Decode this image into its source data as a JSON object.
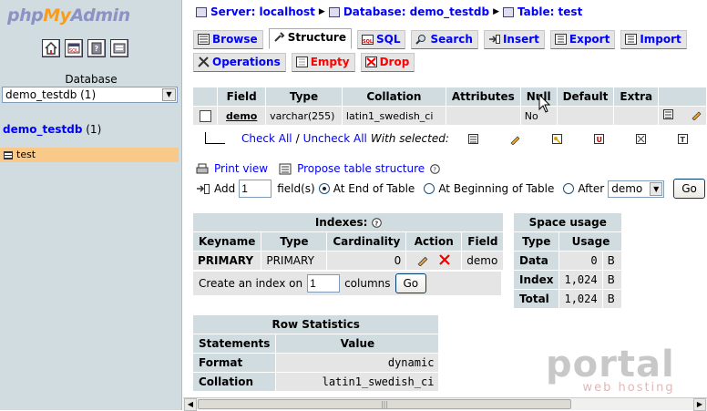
{
  "left": {
    "logo": {
      "php": "php",
      "my": "My",
      "admin": "Admin"
    },
    "nav_icons": [
      "home-icon",
      "sql-query-icon",
      "docs-icon",
      "info-icon"
    ],
    "database_label": "Database",
    "database_select": "demo_testdb (1)",
    "db_link": "demo_testdb",
    "db_count": "(1)",
    "table_item": "test"
  },
  "breadcrumb": {
    "server": "Server: localhost",
    "database": "Database: demo_testdb",
    "table": "Table: test"
  },
  "tabs_row1": [
    "Browse",
    "Structure",
    "SQL",
    "Search",
    "Insert",
    "Export",
    "Import"
  ],
  "tabs_row2": [
    "Operations",
    "Empty",
    "Drop"
  ],
  "structure": {
    "headers": [
      "Field",
      "Type",
      "Collation",
      "Attributes",
      "Null",
      "Default",
      "Extra"
    ],
    "rows": [
      {
        "field": "demo",
        "type": "varchar(255)",
        "collation": "latin1_swedish_ci",
        "attributes": "",
        "null": "No",
        "default": "",
        "extra": ""
      }
    ]
  },
  "check": {
    "check_all": "Check All",
    "slash": "/",
    "uncheck_all": "Uncheck All",
    "with_selected": "With selected:"
  },
  "print_view": "Print view",
  "propose": "Propose table structure",
  "add": {
    "label": "Add",
    "value": "1",
    "fields": "field(s)",
    "end": "At End of Table",
    "beginning": "At Beginning of Table",
    "after": "After",
    "after_value": "demo",
    "go": "Go"
  },
  "indexes": {
    "title": "Indexes:",
    "headers": [
      "Keyname",
      "Type",
      "Cardinality",
      "Action",
      "Field"
    ],
    "row": {
      "keyname": "PRIMARY",
      "type": "PRIMARY",
      "cardinality": "0",
      "field": "demo"
    },
    "create_prefix": "Create an index on",
    "create_value": "1",
    "create_suffix": "columns",
    "go": "Go"
  },
  "space": {
    "title": "Space usage",
    "headers": [
      "Type",
      "Usage"
    ],
    "rows": [
      {
        "type": "Data",
        "usage": "0",
        "unit": "B"
      },
      {
        "type": "Index",
        "usage": "1,024",
        "unit": "B"
      },
      {
        "type": "Total",
        "usage": "1,024",
        "unit": "B"
      }
    ]
  },
  "rowstats": {
    "title": "Row Statistics",
    "headers": [
      "Statements",
      "Value"
    ],
    "rows": [
      {
        "statement": "Format",
        "value": "dynamic"
      },
      {
        "statement": "Collation",
        "value": "latin1_swedish_ci"
      }
    ]
  },
  "watermark": {
    "big": "portal",
    "small": "web hosting"
  },
  "colors": {
    "frame": "#d0dce0",
    "cell": "#e5e5e5",
    "link": "#0000ff",
    "selected_table": "#f9c98a",
    "red": "#ff0000"
  }
}
